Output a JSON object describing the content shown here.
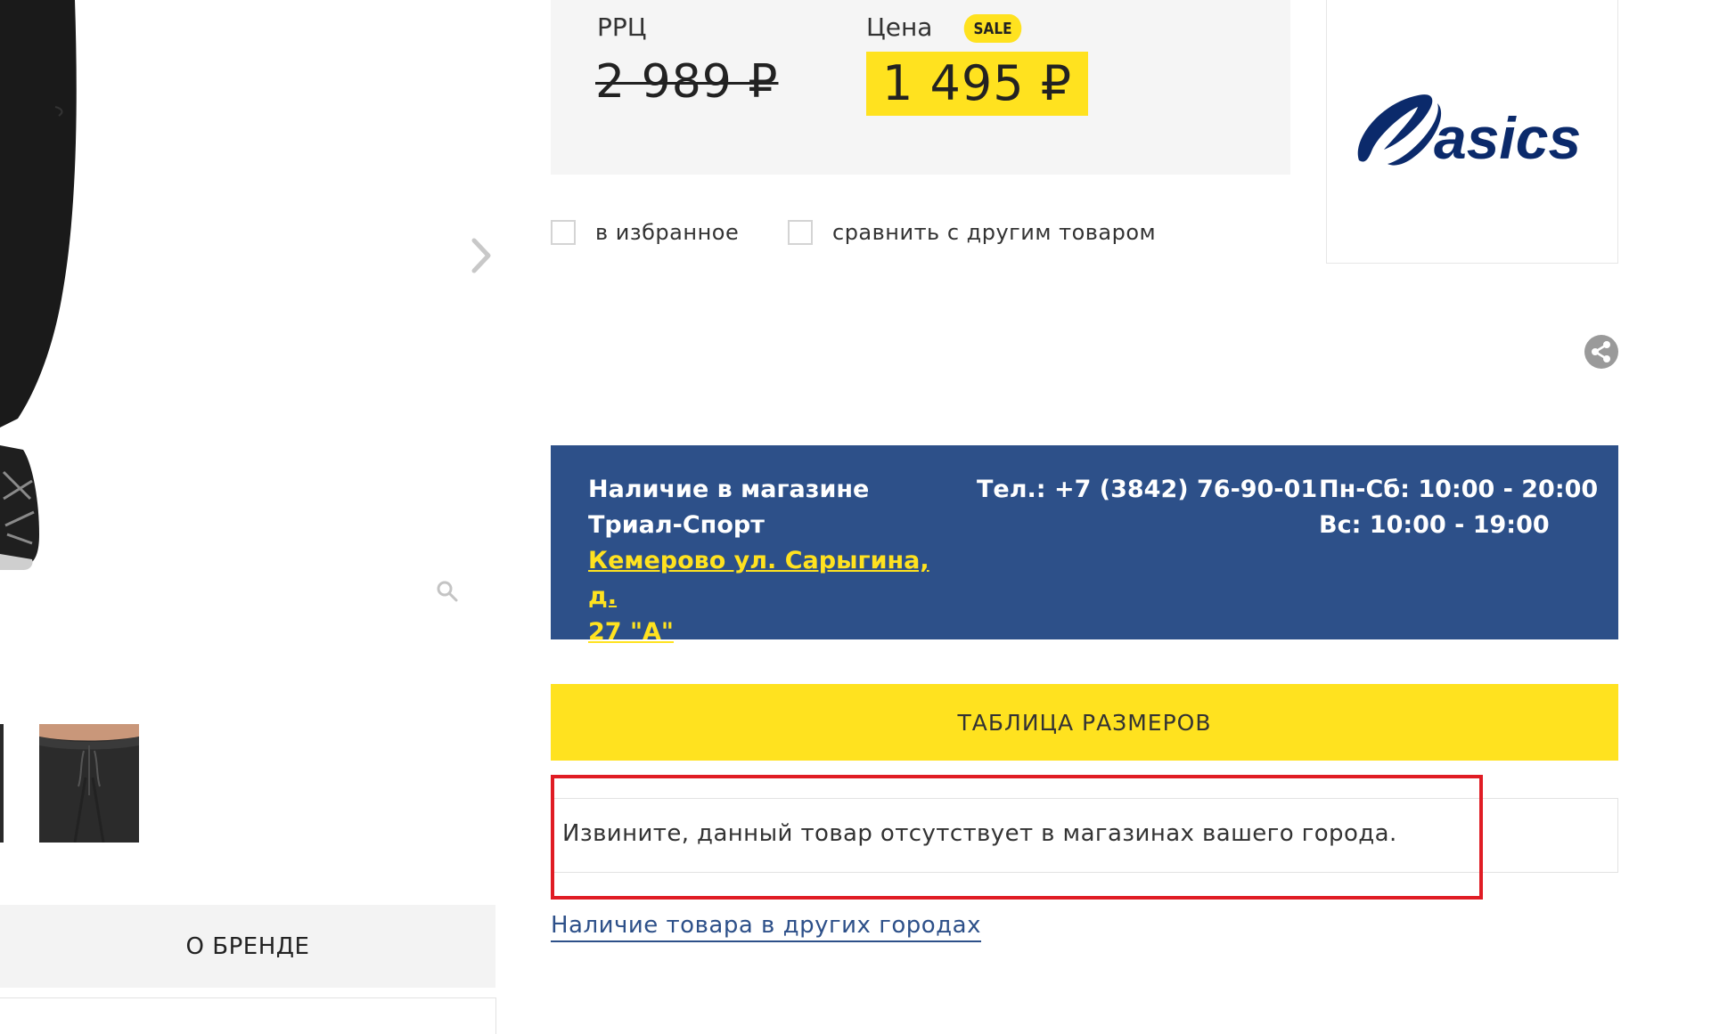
{
  "pricing": {
    "rrc_label": "РРЦ",
    "rrc_value": "2 989 ₽",
    "price_label": "Цена",
    "sale_badge": "SALE",
    "price_value": "1 495 ₽"
  },
  "actions": {
    "favorites_label": "в избранное",
    "compare_label": "сравнить с другим товаром"
  },
  "brand": {
    "logo_text": "asics"
  },
  "store": {
    "title_line1": "Наличие в магазине",
    "title_line2": "Триал-Спорт",
    "address_line1": "Кемерово ул. Сарыгина, д.",
    "address_line2": "27 \"А\"",
    "phone": "Тел.: +7 (3842) 76-90-01",
    "hours_weekdays": "Пн-Сб: 10:00 - 20:00",
    "hours_sunday": "Вс: 10:00 - 19:00"
  },
  "size_table_label": "ТАБЛИЦА РАЗМЕРОВ",
  "availability_notice": "Извините, данный товар отсутствует в магазинах вашего города.",
  "other_cities_link": "Наличие товара в других городах",
  "brand_tab_label": "О БРЕНДЕ",
  "colors": {
    "accent_yellow": "#ffe21f",
    "store_blue": "#2d5089",
    "highlight_red": "#e01c24"
  },
  "icons": {
    "next": "chevron-right-icon",
    "zoom": "magnifier-icon",
    "share": "share-icon"
  }
}
